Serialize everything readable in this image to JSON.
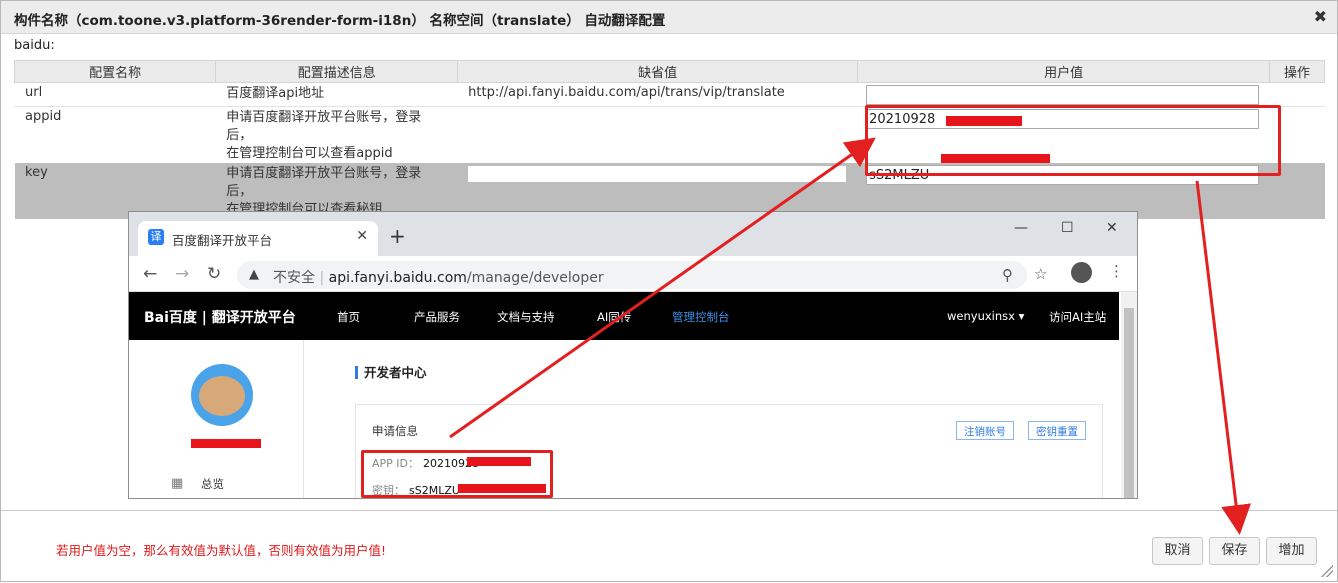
{
  "dialog": {
    "title": "构件名称（com.toone.v3.platform-36render-form-i18n）  名称空间（translate）  自动翻译配置",
    "close_icon": "close-icon"
  },
  "group_label": "baidu:",
  "table": {
    "headers": [
      "配置名称",
      "配置描述信息",
      "缺省值",
      "用户值",
      "操作"
    ],
    "rows": [
      {
        "name": "url",
        "desc_line1": "百度翻译api地址",
        "desc_line2": "",
        "default": "http://api.fanyi.baidu.com/api/trans/vip/translate",
        "user_value": ""
      },
      {
        "name": "appid",
        "desc_line1": "申请百度翻译开放平台账号，登录后，",
        "desc_line2": "在管理控制台可以查看appid",
        "default": "",
        "user_value": "20210928"
      },
      {
        "name": "key",
        "desc_line1": "申请百度翻译开放平台账号，登录后，",
        "desc_line2": "在管理控制台可以查看秘钥",
        "default": "",
        "user_value": "sS2MLZU"
      }
    ]
  },
  "browser": {
    "tab_favicon": "译",
    "tab_title": "百度翻译开放平台",
    "omni_security": "不安全",
    "omni_url_host": "api.fanyi.baidu.com",
    "omni_url_path": "/manage/developer",
    "site": {
      "logo": "Bai百度 | 翻译开放平台",
      "nav": [
        "首页",
        "产品服务",
        "文档与支持",
        "AI同传",
        "管理控制台"
      ],
      "user": "wenyuxinsx ▾",
      "visit_ai": "访问AI主站",
      "sidebar_item": "总览",
      "dev_center": "开发者中心",
      "card_title": "申请信息",
      "btn_cancel_account": "注销账号",
      "btn_reset_key": "密钥重置",
      "app_id_label": "APP ID：",
      "app_id_value": "20210928",
      "key_label": "密钥：",
      "key_value": "sS2MLZU"
    }
  },
  "footer": {
    "hint": "若用户值为空，那么有效值为默认值，否则有效值为用户值!",
    "cancel": "取消",
    "save": "保存",
    "add": "增加"
  },
  "colors": {
    "annotation_red": "#e32020",
    "hint_red": "#e01a1a",
    "active_nav": "#3a8ee6"
  }
}
